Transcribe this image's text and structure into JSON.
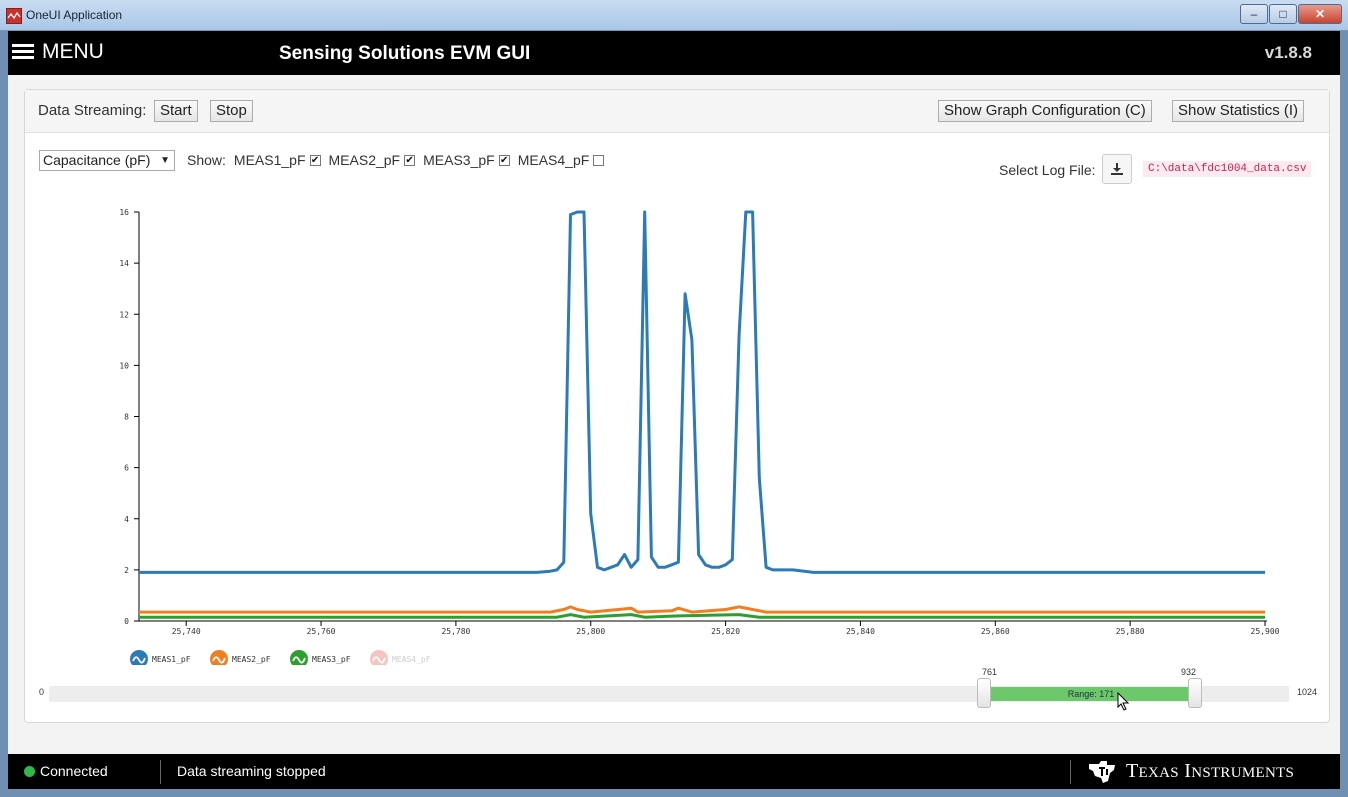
{
  "window": {
    "title": "OneUI Application"
  },
  "header": {
    "menu_label": "MENU",
    "title": "Sensing Solutions EVM GUI",
    "version": "v1.8.8"
  },
  "toolbar": {
    "data_streaming_label": "Data Streaming:",
    "start_label": "Start",
    "stop_label": "Stop",
    "show_graph_config_label": "Show Graph Configuration (C)",
    "show_statistics_label": "Show Statistics (I)"
  },
  "controls": {
    "units_selected": "Capacitance (pF)",
    "show_label": "Show:",
    "channels": [
      {
        "label": "MEAS1_pF",
        "checked": true
      },
      {
        "label": "MEAS2_pF",
        "checked": true
      },
      {
        "label": "MEAS3_pF",
        "checked": true
      },
      {
        "label": "MEAS4_pF",
        "checked": false
      }
    ],
    "log_file_label": "Select Log File:",
    "log_file_path": "C:\\data\\fdc1004_data.csv"
  },
  "chart_data": {
    "type": "line",
    "xlim": [
      25733,
      25900
    ],
    "ylim": [
      0,
      16
    ],
    "x_ticks": [
      25740,
      25760,
      25780,
      25800,
      25820,
      25840,
      25860,
      25880,
      25900
    ],
    "x_tick_labels": [
      "25,740",
      "25,760",
      "25,780",
      "25,800",
      "25,820",
      "25,840",
      "25,860",
      "25,880",
      "25,900"
    ],
    "y_ticks": [
      0,
      2,
      4,
      6,
      8,
      10,
      12,
      14,
      16
    ],
    "y_tick_labels": [
      "0",
      "2",
      "4",
      "6",
      "8",
      "10",
      "12",
      "14",
      "16"
    ],
    "legend_position": "bottom-left",
    "series": [
      {
        "name": "MEAS1_pF",
        "color": "#2b7bb9",
        "enabled": true,
        "points": [
          [
            25733,
            1.9
          ],
          [
            25792,
            1.9
          ],
          [
            25794,
            1.95
          ],
          [
            25795,
            2.0
          ],
          [
            25796,
            2.3
          ],
          [
            25797,
            15.9
          ],
          [
            25798,
            16.0
          ],
          [
            25799,
            16.0
          ],
          [
            25800,
            4.2
          ],
          [
            25801,
            2.1
          ],
          [
            25802,
            2.0
          ],
          [
            25803,
            2.1
          ],
          [
            25804,
            2.2
          ],
          [
            25805,
            2.6
          ],
          [
            25806,
            2.1
          ],
          [
            25807,
            2.4
          ],
          [
            25808,
            16.0
          ],
          [
            25809,
            2.5
          ],
          [
            25810,
            2.1
          ],
          [
            25811,
            2.1
          ],
          [
            25812,
            2.2
          ],
          [
            25813,
            2.3
          ],
          [
            25814,
            12.8
          ],
          [
            25815,
            11.0
          ],
          [
            25816,
            2.6
          ],
          [
            25817,
            2.2
          ],
          [
            25818,
            2.1
          ],
          [
            25819,
            2.1
          ],
          [
            25820,
            2.2
          ],
          [
            25821,
            2.4
          ],
          [
            25822,
            11.2
          ],
          [
            25823,
            16.0
          ],
          [
            25824,
            16.0
          ],
          [
            25825,
            5.6
          ],
          [
            25826,
            2.1
          ],
          [
            25827,
            2.0
          ],
          [
            25830,
            2.0
          ],
          [
            25833,
            1.9
          ],
          [
            25900,
            1.9
          ]
        ]
      },
      {
        "name": "MEAS2_pF",
        "color": "#f07f20",
        "enabled": true,
        "points": [
          [
            25733,
            0.35
          ],
          [
            25794,
            0.35
          ],
          [
            25796,
            0.45
          ],
          [
            25797,
            0.55
          ],
          [
            25798,
            0.45
          ],
          [
            25800,
            0.35
          ],
          [
            25806,
            0.5
          ],
          [
            25807,
            0.35
          ],
          [
            25812,
            0.4
          ],
          [
            25813,
            0.5
          ],
          [
            25815,
            0.35
          ],
          [
            25820,
            0.45
          ],
          [
            25822,
            0.55
          ],
          [
            25824,
            0.45
          ],
          [
            25826,
            0.35
          ],
          [
            25900,
            0.35
          ]
        ]
      },
      {
        "name": "MEAS3_pF",
        "color": "#2ca02c",
        "enabled": true,
        "points": [
          [
            25733,
            0.15
          ],
          [
            25795,
            0.15
          ],
          [
            25797,
            0.25
          ],
          [
            25799,
            0.15
          ],
          [
            25806,
            0.25
          ],
          [
            25808,
            0.15
          ],
          [
            25813,
            0.2
          ],
          [
            25822,
            0.25
          ],
          [
            25825,
            0.15
          ],
          [
            25900,
            0.15
          ]
        ]
      },
      {
        "name": "MEAS4_pF",
        "color": "#f5c4c0",
        "enabled": false,
        "points": []
      }
    ]
  },
  "range_slider": {
    "min": 0,
    "max": 1024,
    "low": 761,
    "high": 932,
    "min_label": "0",
    "max_label": "1024",
    "low_label": "761",
    "high_label": "932",
    "range_text": "Range: 171"
  },
  "status": {
    "connected_text": "Connected",
    "connected_color": "#2fb94a",
    "stream_status": "Data streaming stopped",
    "brand_first": "T",
    "brand_first_sc": "EXAS",
    "brand_second": "I",
    "brand_second_sc": "NSTRUMENTS"
  }
}
